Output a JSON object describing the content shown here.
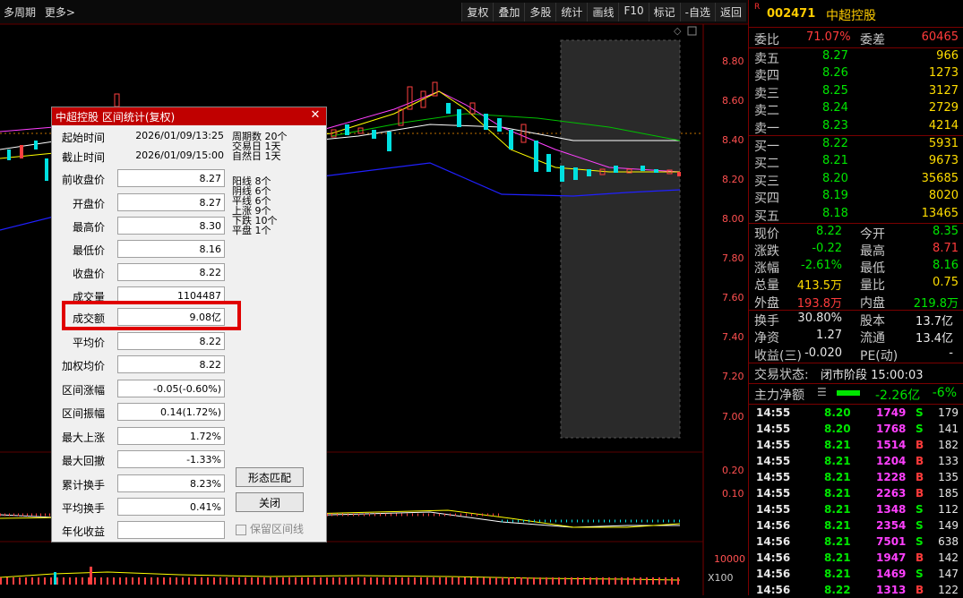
{
  "toolbar": {
    "left": [
      "多周期",
      "更多>"
    ],
    "menu": [
      "复权",
      "叠加",
      "多股",
      "统计",
      "画线",
      "F10",
      "标记",
      "-自选",
      "返回"
    ]
  },
  "chart": {
    "price_ticks": [
      "8.80",
      "8.60",
      "8.40",
      "8.20",
      "8.00",
      "7.80",
      "7.60",
      "7.40",
      "7.20",
      "7.00"
    ],
    "macd_ticks": [
      "0.20",
      "0.10"
    ],
    "vol_tick": "10000",
    "vol_unit": "X100"
  },
  "stock": {
    "r_mark": "R",
    "code": "002471",
    "name": "中超控股"
  },
  "quote": {
    "weibi_label": "委比",
    "weibi": "71.07%",
    "weicha_label": "委差",
    "weicha": "60465",
    "asks": [
      {
        "label": "卖五",
        "price": "8.27",
        "vol": "966"
      },
      {
        "label": "卖四",
        "price": "8.26",
        "vol": "1273"
      },
      {
        "label": "卖三",
        "price": "8.25",
        "vol": "3127"
      },
      {
        "label": "卖二",
        "price": "8.24",
        "vol": "2729"
      },
      {
        "label": "卖一",
        "price": "8.23",
        "vol": "4214"
      }
    ],
    "bids": [
      {
        "label": "买一",
        "price": "8.22",
        "vol": "5931"
      },
      {
        "label": "买二",
        "price": "8.21",
        "vol": "9673"
      },
      {
        "label": "买三",
        "price": "8.20",
        "vol": "35685"
      },
      {
        "label": "买四",
        "price": "8.19",
        "vol": "8020"
      },
      {
        "label": "买五",
        "price": "8.18",
        "vol": "13465"
      }
    ],
    "stats1": [
      {
        "l1": "现价",
        "v1": "8.22",
        "c1": "green",
        "l2": "今开",
        "v2": "8.35",
        "c2": "green"
      },
      {
        "l1": "涨跌",
        "v1": "-0.22",
        "c1": "green",
        "l2": "最高",
        "v2": "8.71",
        "c2": "red"
      },
      {
        "l1": "涨幅",
        "v1": "-2.61%",
        "c1": "green",
        "l2": "最低",
        "v2": "8.16",
        "c2": "green"
      },
      {
        "l1": "总量",
        "v1": "413.5万",
        "c1": "yellow",
        "l2": "量比",
        "v2": "0.75",
        "c2": "yellow"
      },
      {
        "l1": "外盘",
        "v1": "193.8万",
        "c1": "red",
        "l2": "内盘",
        "v2": "219.8万",
        "c2": "green"
      }
    ],
    "stats2": [
      {
        "l1": "换手",
        "v1": "30.80%",
        "l2": "股本",
        "v2": "13.7亿"
      },
      {
        "l1": "净资",
        "v1": "1.27",
        "l2": "流通",
        "v2": "13.4亿"
      },
      {
        "l1": "收益(三)",
        "v1": "-0.020",
        "l2": "PE(动)",
        "v2": "-"
      }
    ],
    "status_label": "交易状态:",
    "status": "闭市阶段 15:00:03",
    "flow_label": "主力净额",
    "flow": "-2.26亿",
    "flow_pct": "-6%"
  },
  "ticks": [
    {
      "t": "14:55",
      "p": "8.20",
      "v": "1749",
      "s": "S",
      "n": "179"
    },
    {
      "t": "14:55",
      "p": "8.20",
      "v": "1768",
      "s": "S",
      "n": "141"
    },
    {
      "t": "14:55",
      "p": "8.21",
      "v": "1514",
      "s": "B",
      "n": "182"
    },
    {
      "t": "14:55",
      "p": "8.21",
      "v": "1204",
      "s": "B",
      "n": "133"
    },
    {
      "t": "14:55",
      "p": "8.21",
      "v": "1228",
      "s": "B",
      "n": "135"
    },
    {
      "t": "14:55",
      "p": "8.21",
      "v": "2263",
      "s": "B",
      "n": "185"
    },
    {
      "t": "14:55",
      "p": "8.21",
      "v": "1348",
      "s": "S",
      "n": "112"
    },
    {
      "t": "14:56",
      "p": "8.21",
      "v": "2354",
      "s": "S",
      "n": "149"
    },
    {
      "t": "14:56",
      "p": "8.21",
      "v": "7501",
      "s": "S",
      "n": "638"
    },
    {
      "t": "14:56",
      "p": "8.21",
      "v": "1947",
      "s": "B",
      "n": "142"
    },
    {
      "t": "14:56",
      "p": "8.21",
      "v": "1469",
      "s": "S",
      "n": "147"
    },
    {
      "t": "14:56",
      "p": "8.22",
      "v": "1313",
      "s": "B",
      "n": "122"
    }
  ],
  "dialog": {
    "title": "中超控股 区间统计(复权)",
    "fields": [
      {
        "label": "起始时间",
        "value": "2026/01/09/13:25"
      },
      {
        "label": "截止时间",
        "value": "2026/01/09/15:00"
      },
      {
        "label": "前收盘价",
        "value": "8.27"
      },
      {
        "label": "开盘价",
        "value": "8.27"
      },
      {
        "label": "最高价",
        "value": "8.30"
      },
      {
        "label": "最低价",
        "value": "8.16"
      },
      {
        "label": "收盘价",
        "value": "8.22"
      },
      {
        "label": "成交量",
        "value": "1104487"
      },
      {
        "label": "成交额",
        "value": "9.08亿"
      },
      {
        "label": "平均价",
        "value": "8.22"
      },
      {
        "label": "加权均价",
        "value": "8.22"
      },
      {
        "label": "区间涨幅",
        "value": "-0.05(-0.60%)"
      },
      {
        "label": "区间振幅",
        "value": "0.14(1.72%)"
      },
      {
        "label": "最大上涨",
        "value": "1.72%"
      },
      {
        "label": "最大回撤",
        "value": "-1.33%"
      },
      {
        "label": "累计换手",
        "value": "8.23%"
      },
      {
        "label": "平均换手",
        "value": "0.41%"
      },
      {
        "label": "年化收益",
        "value": ""
      }
    ],
    "period_stats": [
      "周期数 20个",
      "交易日 1天",
      "自然日 1天"
    ],
    "bar_stats": [
      "阳线 8个",
      "阴线 6个",
      "平线 6个",
      "上涨 9个",
      "下跌 10个",
      "平盘 1个"
    ],
    "btn_match": "形态匹配",
    "btn_close": "关闭",
    "keep_line": "保留区间线"
  }
}
